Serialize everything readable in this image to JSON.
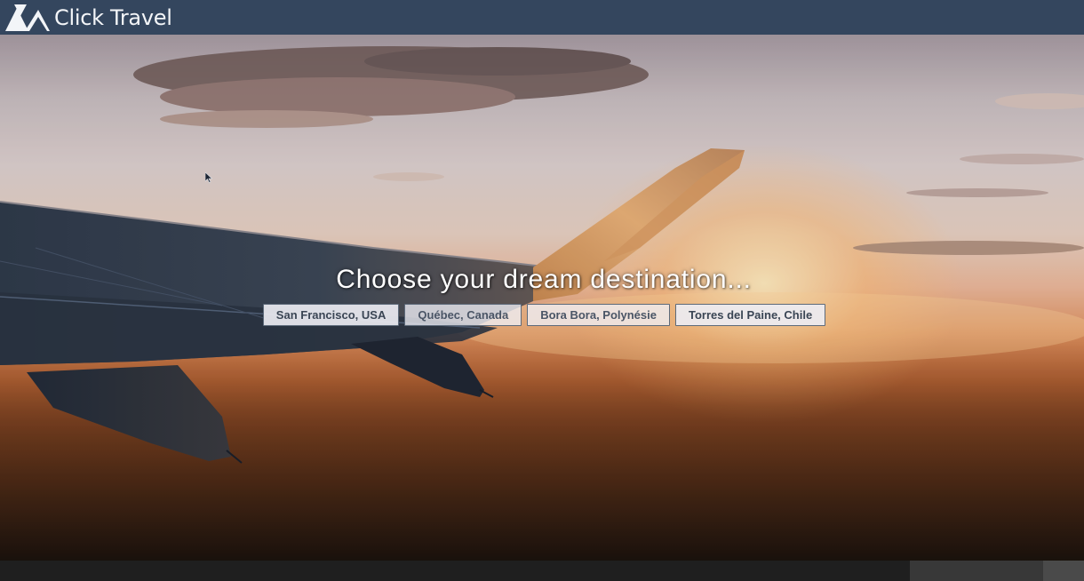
{
  "header": {
    "brand_name": "Click Travel",
    "logo_icon": "mountain-logo-icon",
    "background_color": "#34465e"
  },
  "hero": {
    "image": "airplane-wing-sunset-image",
    "headline": "Choose your dream destination...",
    "destinations": [
      "San Francisco, USA",
      "Québec, Canada",
      "Bora Bora, Polynésie",
      "Torres del Paine, Chile"
    ]
  },
  "footer": {
    "background_color": "#1f1f1f"
  }
}
